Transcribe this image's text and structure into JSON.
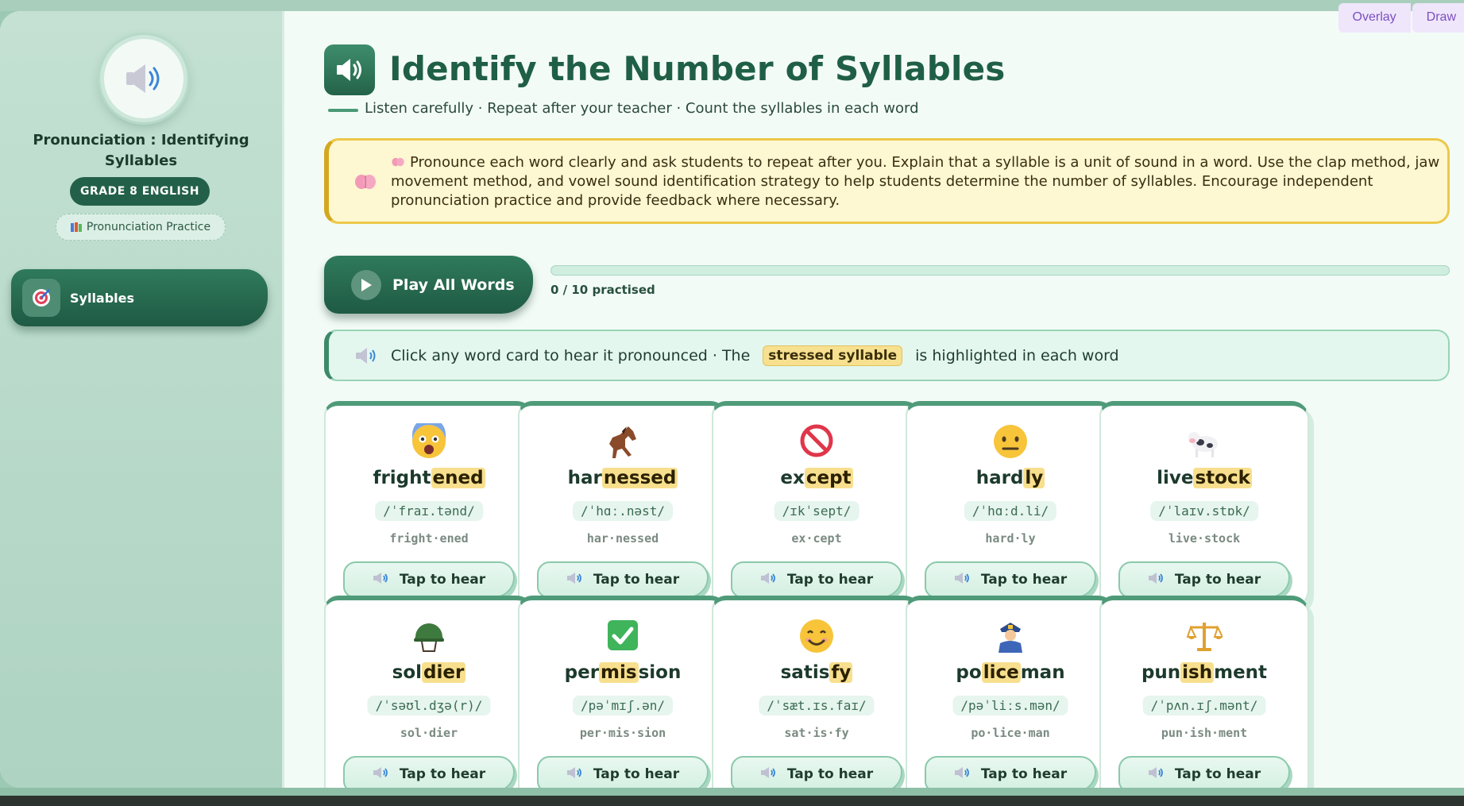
{
  "top_tabs": [
    "Overlay",
    "Draw"
  ],
  "sidebar": {
    "title": "Pronunciation : Identifying Syllables",
    "grade_badge": "GRADE 8 ENGLISH",
    "chip": "Pronunciation Practice",
    "nav_items": [
      {
        "label": "Syllables"
      }
    ]
  },
  "header": {
    "title": "Identify the Number of Syllables",
    "subtitle": "Listen carefully · Repeat after your teacher · Count the syllables in each word"
  },
  "note": "Pronounce each word clearly and ask students to repeat after you. Explain that a syllable is a unit of sound in a word. Use the clap method, jaw movement method, and vowel sound identification strategy to help students determine the number of syllables. Encourage independent pronunciation practice and provide feedback where necessary.",
  "play": {
    "label": "Play All Words",
    "progress_text": "0 / 10 practised",
    "progress_fraction": 0
  },
  "hint": {
    "before": "Click any word card to hear it pronounced · The",
    "highlight": "stressed syllable",
    "after": "is highlighted in each word"
  },
  "tap_label": "Tap to hear",
  "words": [
    {
      "icon": "fearful-face-icon",
      "parts": [
        "fright",
        "ened"
      ],
      "stressed": 1,
      "ipa": "/ˈfraɪ.tənd/",
      "split": "fright·ened"
    },
    {
      "icon": "horse-icon",
      "parts": [
        "har",
        "nessed"
      ],
      "stressed": 1,
      "ipa": "/ˈhɑː.nəst/",
      "split": "har·nessed"
    },
    {
      "icon": "prohibited-icon",
      "parts": [
        "ex",
        "cept"
      ],
      "stressed": 1,
      "ipa": "/ɪkˈsept/",
      "split": "ex·cept"
    },
    {
      "icon": "neutral-face-icon",
      "parts": [
        "hard",
        "ly"
      ],
      "stressed": 1,
      "ipa": "/ˈhɑːd.li/",
      "split": "hard·ly"
    },
    {
      "icon": "cow-icon",
      "parts": [
        "live",
        "stock"
      ],
      "stressed": 1,
      "ipa": "/ˈlaɪv.stɒk/",
      "split": "live·stock"
    },
    {
      "icon": "military-helmet-icon",
      "parts": [
        "sol",
        "dier"
      ],
      "stressed": 1,
      "ipa": "/ˈsəʊl.dʒə(r)/",
      "split": "sol·dier"
    },
    {
      "icon": "check-mark-icon",
      "parts": [
        "per",
        "mis",
        "sion"
      ],
      "stressed": 1,
      "ipa": "/pəˈmɪʃ.ən/",
      "split": "per·mis·sion"
    },
    {
      "icon": "smiling-face-icon",
      "parts": [
        "satis",
        "fy"
      ],
      "stressed": 1,
      "ipa": "/ˈsæt.ɪs.faɪ/",
      "split": "sat·is·fy"
    },
    {
      "icon": "police-officer-icon",
      "parts": [
        "po",
        "lice",
        "man"
      ],
      "stressed": 1,
      "ipa": "/pəˈliːs.mən/",
      "split": "po·lice·man"
    },
    {
      "icon": "scales-icon",
      "parts": [
        "pun",
        "ish",
        "ment"
      ],
      "stressed": 1,
      "ipa": "/ˈpʌn.ɪʃ.mənt/",
      "split": "pun·ish·ment"
    }
  ]
}
